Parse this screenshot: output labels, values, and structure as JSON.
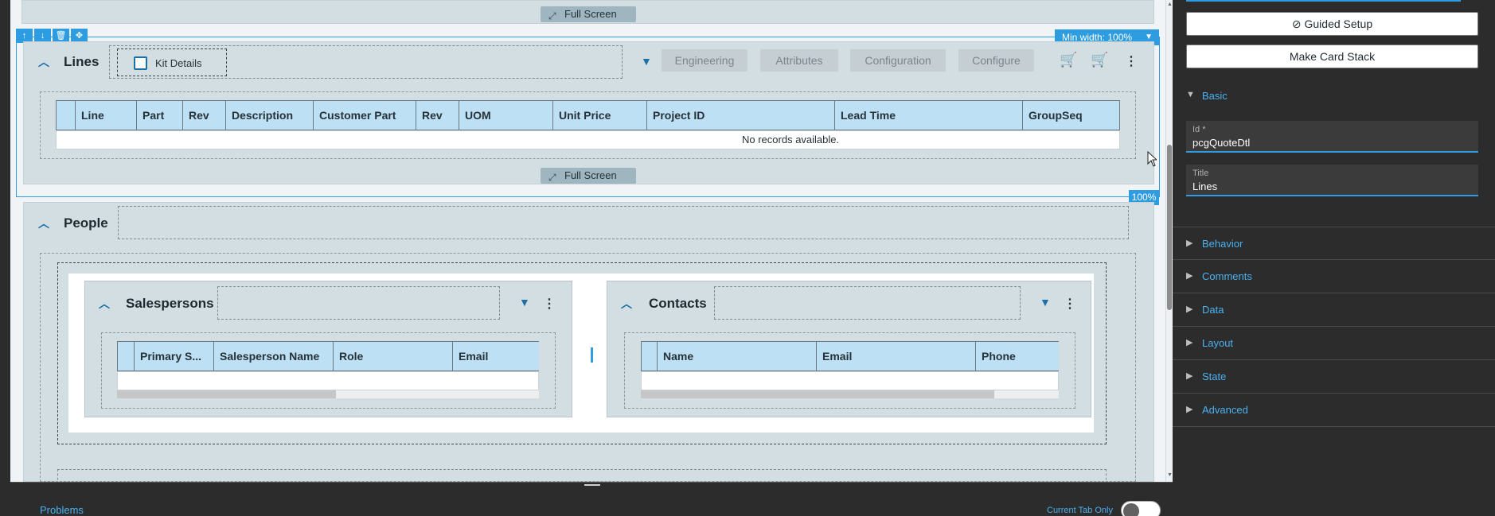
{
  "canvas": {
    "full_screen_label": "Full Screen",
    "min_width_label": "Min width: 100%",
    "percent_badge": "100%",
    "lines_card": {
      "title": "Lines",
      "kit_details_label": "Kit Details",
      "tabs": [
        "Engineering",
        "Attributes",
        "Configuration",
        "Configure"
      ],
      "grid_columns": [
        "",
        "Line",
        "Part",
        "Rev",
        "Description",
        "Customer Part",
        "Rev",
        "UOM",
        "Unit Price",
        "Project ID",
        "Lead Time",
        "GroupSeq"
      ],
      "no_records": "No records available."
    },
    "people_card": {
      "title": "People",
      "salespersons": {
        "title": "Salespersons",
        "grid_columns": [
          "",
          "Primary S...",
          "Salesperson Name",
          "Role",
          "Email"
        ]
      },
      "contacts": {
        "title": "Contacts",
        "grid_columns": [
          "",
          "Name",
          "Email",
          "Phone"
        ]
      }
    }
  },
  "bottom_bar": {
    "problems_label": "Problems",
    "current_tab_only_label": "Current Tab Only",
    "current_tab_only_on": false
  },
  "panel": {
    "guided_setup_label": "Guided Setup",
    "make_card_stack_label": "Make Card Stack",
    "basic_section": "Basic",
    "id_label": "Id *",
    "id_value": "pcgQuoteDtl",
    "title_label": "Title",
    "title_value": "Lines",
    "sections": [
      "Behavior",
      "Comments",
      "Data",
      "Layout",
      "State",
      "Advanced"
    ]
  },
  "colors": {
    "accent": "#2d9ce0",
    "card_bg": "#d3dee3",
    "grid_header": "#bde0f5",
    "panel_bg": "#2c2c2c"
  }
}
